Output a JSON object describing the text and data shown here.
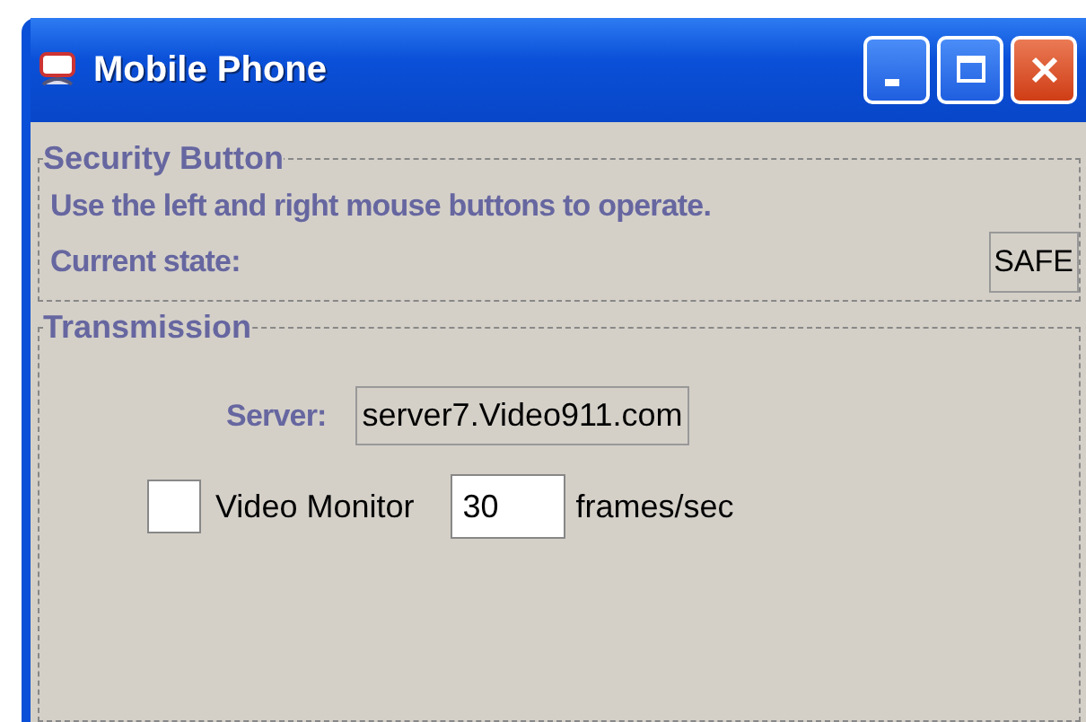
{
  "window": {
    "title": "Mobile Phone"
  },
  "security": {
    "title": "Security Button",
    "instructions": "Use the left and right mouse buttons to operate.",
    "state_label": "Current state:",
    "state_value": "SAFE"
  },
  "transmission": {
    "title": "Transmission",
    "server_label": "Server:",
    "server_value": "server7.Video911.com",
    "monitor": {
      "label": "Video Monitor",
      "checked": false
    },
    "fps_value": "30",
    "fps_unit": "frames/sec"
  }
}
